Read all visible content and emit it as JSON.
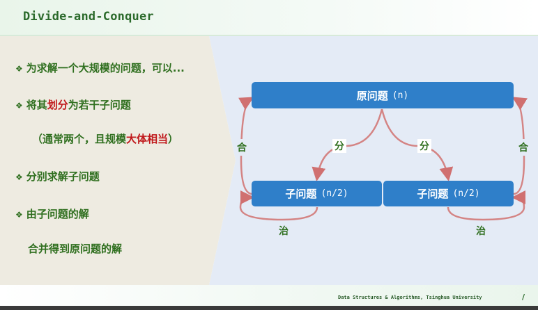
{
  "header": {
    "title": "Divide-and-Conquer"
  },
  "bullets": {
    "b1": {
      "icon": "diamond-bullet-icon",
      "text": "为求解一个大规模的问题，可以..."
    },
    "b2": {
      "icon": "diamond-bullet-icon",
      "prefix": "将其",
      "highlight": "划分",
      "suffix": "为若干子问题"
    },
    "b2sub": {
      "prefix": "（通常两个，且规模",
      "highlight": "大体相当",
      "suffix": "）"
    },
    "b3": {
      "icon": "diamond-bullet-icon",
      "text": "分别求解子问题"
    },
    "b4": {
      "icon": "diamond-bullet-icon",
      "text": "由子问题的解"
    },
    "b4sub": {
      "text": "合并得到原问题的解"
    }
  },
  "diagram": {
    "root": {
      "label": "原问题",
      "size": "(n)"
    },
    "left_child": {
      "label": "子问题",
      "size": "(n/2)"
    },
    "right_child": {
      "label": "子问题",
      "size": "(n/2)"
    },
    "divide_left": "分",
    "divide_right": "分",
    "combine_left": "合",
    "combine_right": "合",
    "conquer_left": "治",
    "conquer_right": "治"
  },
  "footer": {
    "course": "Data Structures & Algorithms, Tsinghua University",
    "page": "/"
  },
  "colors": {
    "green_text": "#2f6f1f",
    "highlight_red": "#c0181b",
    "box_blue": "#2f7fc9",
    "arrow_red": "#d07070",
    "panel_beige": "#eeebe1",
    "diagram_bg": "#e4ebf6"
  }
}
